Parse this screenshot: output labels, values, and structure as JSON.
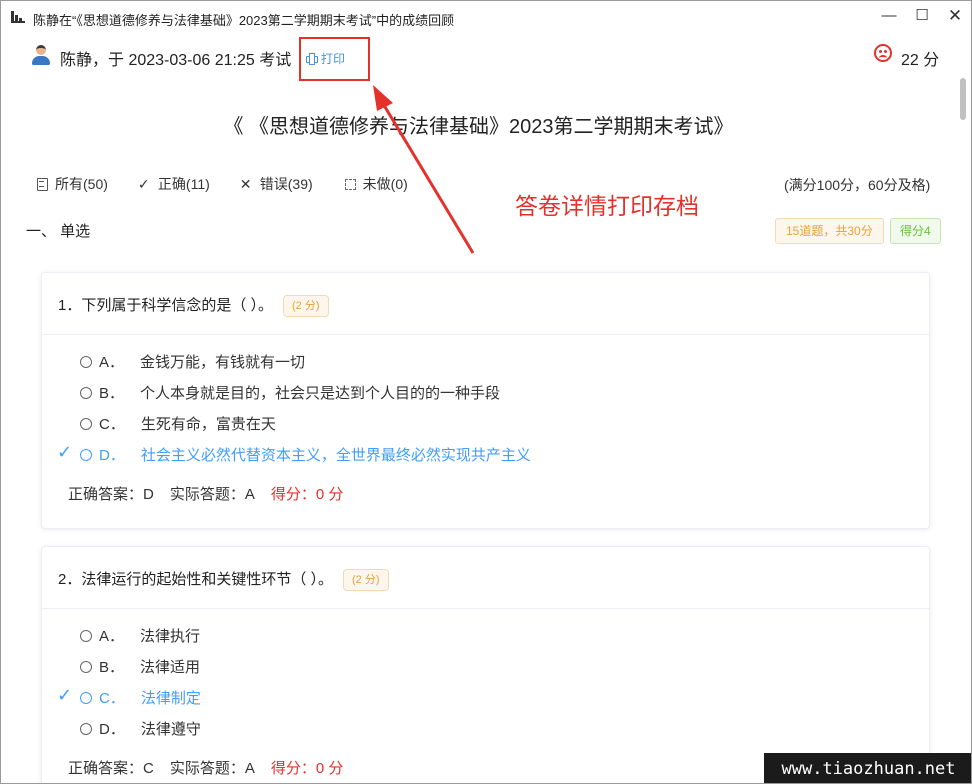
{
  "window": {
    "title": "陈静在“《思想道德修养与法律基础》2023第二学期期末考试”中的成绩回顾",
    "minimize_glyph": "—",
    "maximize_glyph": "☐",
    "close_glyph": "✕"
  },
  "header": {
    "user_line": "陈静，于 2023-03-06 21:25 考试",
    "print_label": "打印",
    "total_score": "22 分"
  },
  "exam_title": "《 《思想道德修养与法律基础》2023第二学期期末考试》",
  "filters": [
    {
      "label": "所有(50)",
      "icon": "list-icon"
    },
    {
      "label": "正确(11)",
      "icon": "check-icon"
    },
    {
      "label": "错误(39)",
      "icon": "cross-icon"
    },
    {
      "label": "未做(0)",
      "icon": "empty-box-icon"
    }
  ],
  "full_score_note": "(满分100分，60分及格)",
  "annotation": "答卷详情打印存档",
  "section": {
    "title": "一、 单选",
    "count_badge": "15道题，共30分",
    "score_badge": "得分4"
  },
  "questions": [
    {
      "text": "1．下列属于科学信念的是（ ）。",
      "points": "(2 分)",
      "options": [
        {
          "letter": "A．",
          "text": "金钱万能，有钱就有一切",
          "correct": false
        },
        {
          "letter": "B．",
          "text": "个人本身就是目的，社会只是达到个人目的的一种手段",
          "correct": false
        },
        {
          "letter": "C．",
          "text": "生死有命，富贵在天",
          "correct": false
        },
        {
          "letter": "D．",
          "text": "社会主义必然代替资本主义，全世界最终必然实现共产主义",
          "correct": true
        }
      ],
      "correct_answer": "正确答案：D",
      "actual_answer": "实际答题：A",
      "score": "得分：0 分"
    },
    {
      "text": "2．法律运行的起始性和关键性环节（ ）。",
      "points": "(2 分)",
      "options": [
        {
          "letter": "A．",
          "text": "法律执行",
          "correct": false
        },
        {
          "letter": "B．",
          "text": "法律适用",
          "correct": false
        },
        {
          "letter": "C．",
          "text": "法律制定",
          "correct": true
        },
        {
          "letter": "D．",
          "text": "法律遵守",
          "correct": false
        }
      ],
      "correct_answer": "正确答案：C",
      "actual_answer": "实际答题：A",
      "score": "得分：0 分"
    }
  ],
  "watermark": "www.tiaozhuan.net",
  "colors": {
    "accent_blue": "#409eff",
    "error_red": "#e5312c",
    "warning_orange": "#e6a23c",
    "success_green": "#67c23a"
  }
}
